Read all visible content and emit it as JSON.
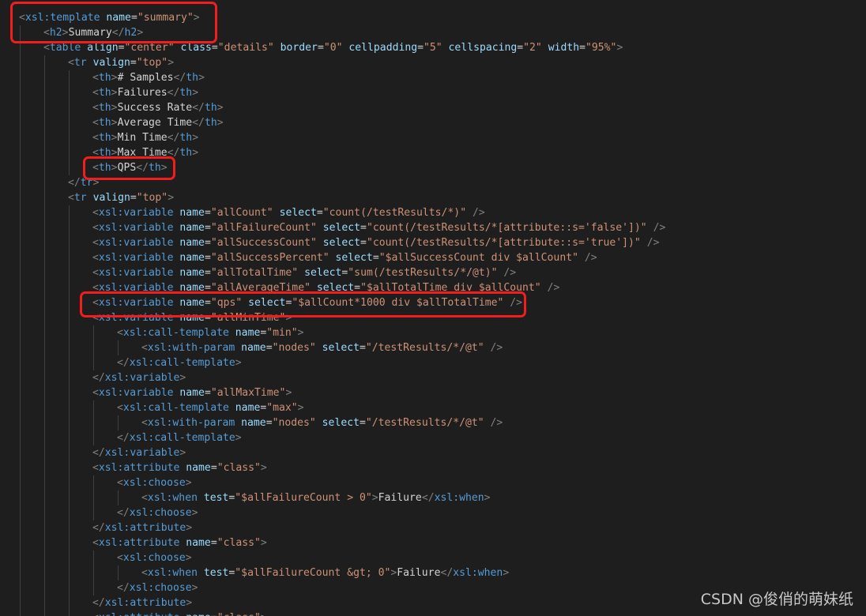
{
  "editor": {
    "lines": [
      [
        [
          "<",
          "punc"
        ],
        [
          "xsl:template",
          "tag"
        ],
        [
          " ",
          "text"
        ],
        [
          "name",
          "attr"
        ],
        [
          "=",
          "text"
        ],
        [
          "\"summary\"",
          "str"
        ],
        [
          ">",
          "punc"
        ]
      ],
      [
        [
          "<",
          "punc"
        ],
        [
          "h2",
          "tag"
        ],
        [
          ">",
          "punc"
        ],
        [
          "Summary",
          "text"
        ],
        [
          "</",
          "punc"
        ],
        [
          "h2",
          "tag"
        ],
        [
          ">",
          "punc"
        ]
      ],
      [
        [
          "<",
          "punc"
        ],
        [
          "table",
          "tag"
        ],
        [
          " ",
          "text"
        ],
        [
          "align",
          "attr"
        ],
        [
          "=",
          "text"
        ],
        [
          "\"center\"",
          "str"
        ],
        [
          " ",
          "text"
        ],
        [
          "class",
          "attr"
        ],
        [
          "=",
          "text"
        ],
        [
          "\"details\"",
          "str"
        ],
        [
          " ",
          "text"
        ],
        [
          "border",
          "attr"
        ],
        [
          "=",
          "text"
        ],
        [
          "\"0\"",
          "str"
        ],
        [
          " ",
          "text"
        ],
        [
          "cellpadding",
          "attr"
        ],
        [
          "=",
          "text"
        ],
        [
          "\"5\"",
          "str"
        ],
        [
          " ",
          "text"
        ],
        [
          "cellspacing",
          "attr"
        ],
        [
          "=",
          "text"
        ],
        [
          "\"2\"",
          "str"
        ],
        [
          " ",
          "text"
        ],
        [
          "width",
          "attr"
        ],
        [
          "=",
          "text"
        ],
        [
          "\"95%\"",
          "str"
        ],
        [
          ">",
          "punc"
        ]
      ],
      [
        [
          "<",
          "punc"
        ],
        [
          "tr",
          "tag"
        ],
        [
          " ",
          "text"
        ],
        [
          "valign",
          "attr"
        ],
        [
          "=",
          "text"
        ],
        [
          "\"top\"",
          "str"
        ],
        [
          ">",
          "punc"
        ]
      ],
      [
        [
          "<",
          "punc"
        ],
        [
          "th",
          "tag"
        ],
        [
          ">",
          "punc"
        ],
        [
          "# Samples",
          "text"
        ],
        [
          "</",
          "punc"
        ],
        [
          "th",
          "tag"
        ],
        [
          ">",
          "punc"
        ]
      ],
      [
        [
          "<",
          "punc"
        ],
        [
          "th",
          "tag"
        ],
        [
          ">",
          "punc"
        ],
        [
          "Failures",
          "text"
        ],
        [
          "</",
          "punc"
        ],
        [
          "th",
          "tag"
        ],
        [
          ">",
          "punc"
        ]
      ],
      [
        [
          "<",
          "punc"
        ],
        [
          "th",
          "tag"
        ],
        [
          ">",
          "punc"
        ],
        [
          "Success Rate",
          "text"
        ],
        [
          "</",
          "punc"
        ],
        [
          "th",
          "tag"
        ],
        [
          ">",
          "punc"
        ]
      ],
      [
        [
          "<",
          "punc"
        ],
        [
          "th",
          "tag"
        ],
        [
          ">",
          "punc"
        ],
        [
          "Average Time",
          "text"
        ],
        [
          "</",
          "punc"
        ],
        [
          "th",
          "tag"
        ],
        [
          ">",
          "punc"
        ]
      ],
      [
        [
          "<",
          "punc"
        ],
        [
          "th",
          "tag"
        ],
        [
          ">",
          "punc"
        ],
        [
          "Min Time",
          "text"
        ],
        [
          "</",
          "punc"
        ],
        [
          "th",
          "tag"
        ],
        [
          ">",
          "punc"
        ]
      ],
      [
        [
          "<",
          "punc"
        ],
        [
          "th",
          "tag"
        ],
        [
          ">",
          "punc"
        ],
        [
          "Max Time",
          "text"
        ],
        [
          "</",
          "punc"
        ],
        [
          "th",
          "tag"
        ],
        [
          ">",
          "punc"
        ]
      ],
      [
        [
          "<",
          "punc"
        ],
        [
          "th",
          "tag"
        ],
        [
          ">",
          "punc"
        ],
        [
          "QPS",
          "text"
        ],
        [
          "</",
          "punc"
        ],
        [
          "th",
          "tag"
        ],
        [
          ">",
          "punc"
        ]
      ],
      [
        [
          "</",
          "punc"
        ],
        [
          "tr",
          "tag"
        ],
        [
          ">",
          "punc"
        ]
      ],
      [
        [
          "<",
          "punc"
        ],
        [
          "tr",
          "tag"
        ],
        [
          " ",
          "text"
        ],
        [
          "valign",
          "attr"
        ],
        [
          "=",
          "text"
        ],
        [
          "\"top\"",
          "str"
        ],
        [
          ">",
          "punc"
        ]
      ],
      [
        [
          "<",
          "punc"
        ],
        [
          "xsl:variable",
          "tag"
        ],
        [
          " ",
          "text"
        ],
        [
          "name",
          "attr"
        ],
        [
          "=",
          "text"
        ],
        [
          "\"allCount\"",
          "str"
        ],
        [
          " ",
          "text"
        ],
        [
          "select",
          "attr"
        ],
        [
          "=",
          "text"
        ],
        [
          "\"count(/testResults/*)\"",
          "str"
        ],
        [
          " ",
          "text"
        ],
        [
          "/>",
          "punc"
        ]
      ],
      [
        [
          "<",
          "punc"
        ],
        [
          "xsl:variable",
          "tag"
        ],
        [
          " ",
          "text"
        ],
        [
          "name",
          "attr"
        ],
        [
          "=",
          "text"
        ],
        [
          "\"allFailureCount\"",
          "str"
        ],
        [
          " ",
          "text"
        ],
        [
          "select",
          "attr"
        ],
        [
          "=",
          "text"
        ],
        [
          "\"count(/testResults/*[attribute::s='false'])\"",
          "str"
        ],
        [
          " ",
          "text"
        ],
        [
          "/>",
          "punc"
        ]
      ],
      [
        [
          "<",
          "punc"
        ],
        [
          "xsl:variable",
          "tag"
        ],
        [
          " ",
          "text"
        ],
        [
          "name",
          "attr"
        ],
        [
          "=",
          "text"
        ],
        [
          "\"allSuccessCount\"",
          "str"
        ],
        [
          " ",
          "text"
        ],
        [
          "select",
          "attr"
        ],
        [
          "=",
          "text"
        ],
        [
          "\"count(/testResults/*[attribute::s='true'])\"",
          "str"
        ],
        [
          " ",
          "text"
        ],
        [
          "/>",
          "punc"
        ]
      ],
      [
        [
          "<",
          "punc"
        ],
        [
          "xsl:variable",
          "tag"
        ],
        [
          " ",
          "text"
        ],
        [
          "name",
          "attr"
        ],
        [
          "=",
          "text"
        ],
        [
          "\"allSuccessPercent\"",
          "str"
        ],
        [
          " ",
          "text"
        ],
        [
          "select",
          "attr"
        ],
        [
          "=",
          "text"
        ],
        [
          "\"$allSuccessCount div $allCount\"",
          "str"
        ],
        [
          " ",
          "text"
        ],
        [
          "/>",
          "punc"
        ]
      ],
      [
        [
          "<",
          "punc"
        ],
        [
          "xsl:variable",
          "tag"
        ],
        [
          " ",
          "text"
        ],
        [
          "name",
          "attr"
        ],
        [
          "=",
          "text"
        ],
        [
          "\"allTotalTime\"",
          "str"
        ],
        [
          " ",
          "text"
        ],
        [
          "select",
          "attr"
        ],
        [
          "=",
          "text"
        ],
        [
          "\"sum(/testResults/*/@t)\"",
          "str"
        ],
        [
          " ",
          "text"
        ],
        [
          "/>",
          "punc"
        ]
      ],
      [
        [
          "<",
          "punc"
        ],
        [
          "xsl:variable",
          "tag"
        ],
        [
          " ",
          "text"
        ],
        [
          "name",
          "attr"
        ],
        [
          "=",
          "text"
        ],
        [
          "\"allAverageTime\"",
          "str"
        ],
        [
          " ",
          "text"
        ],
        [
          "select",
          "attr"
        ],
        [
          "=",
          "text"
        ],
        [
          "\"$allTotalTime div $allCount\"",
          "str"
        ],
        [
          " ",
          "text"
        ],
        [
          "/>",
          "punc"
        ]
      ],
      [
        [
          "<",
          "punc"
        ],
        [
          "xsl:variable",
          "tag"
        ],
        [
          " ",
          "text"
        ],
        [
          "name",
          "attr"
        ],
        [
          "=",
          "text"
        ],
        [
          "\"qps\"",
          "str"
        ],
        [
          " ",
          "text"
        ],
        [
          "select",
          "attr"
        ],
        [
          "=",
          "text"
        ],
        [
          "\"$allCount*1000 div $allTotalTime\"",
          "str"
        ],
        [
          " ",
          "text"
        ],
        [
          "/>",
          "punc"
        ]
      ],
      [
        [
          "<",
          "punc"
        ],
        [
          "xsl:variable",
          "tag"
        ],
        [
          " ",
          "text"
        ],
        [
          "name",
          "attr"
        ],
        [
          "=",
          "text"
        ],
        [
          "\"allMinTime\"",
          "str"
        ],
        [
          ">",
          "punc"
        ]
      ],
      [
        [
          "<",
          "punc"
        ],
        [
          "xsl:call-template",
          "tag"
        ],
        [
          " ",
          "text"
        ],
        [
          "name",
          "attr"
        ],
        [
          "=",
          "text"
        ],
        [
          "\"min\"",
          "str"
        ],
        [
          ">",
          "punc"
        ]
      ],
      [
        [
          "<",
          "punc"
        ],
        [
          "xsl:with-param",
          "tag"
        ],
        [
          " ",
          "text"
        ],
        [
          "name",
          "attr"
        ],
        [
          "=",
          "text"
        ],
        [
          "\"nodes\"",
          "str"
        ],
        [
          " ",
          "text"
        ],
        [
          "select",
          "attr"
        ],
        [
          "=",
          "text"
        ],
        [
          "\"/testResults/*/@t\"",
          "str"
        ],
        [
          " ",
          "text"
        ],
        [
          "/>",
          "punc"
        ]
      ],
      [
        [
          "</",
          "punc"
        ],
        [
          "xsl:call-template",
          "tag"
        ],
        [
          ">",
          "punc"
        ]
      ],
      [
        [
          "</",
          "punc"
        ],
        [
          "xsl:variable",
          "tag"
        ],
        [
          ">",
          "punc"
        ]
      ],
      [
        [
          "<",
          "punc"
        ],
        [
          "xsl:variable",
          "tag"
        ],
        [
          " ",
          "text"
        ],
        [
          "name",
          "attr"
        ],
        [
          "=",
          "text"
        ],
        [
          "\"allMaxTime\"",
          "str"
        ],
        [
          ">",
          "punc"
        ]
      ],
      [
        [
          "<",
          "punc"
        ],
        [
          "xsl:call-template",
          "tag"
        ],
        [
          " ",
          "text"
        ],
        [
          "name",
          "attr"
        ],
        [
          "=",
          "text"
        ],
        [
          "\"max\"",
          "str"
        ],
        [
          ">",
          "punc"
        ]
      ],
      [
        [
          "<",
          "punc"
        ],
        [
          "xsl:with-param",
          "tag"
        ],
        [
          " ",
          "text"
        ],
        [
          "name",
          "attr"
        ],
        [
          "=",
          "text"
        ],
        [
          "\"nodes\"",
          "str"
        ],
        [
          " ",
          "text"
        ],
        [
          "select",
          "attr"
        ],
        [
          "=",
          "text"
        ],
        [
          "\"/testResults/*/@t\"",
          "str"
        ],
        [
          " ",
          "text"
        ],
        [
          "/>",
          "punc"
        ]
      ],
      [
        [
          "</",
          "punc"
        ],
        [
          "xsl:call-template",
          "tag"
        ],
        [
          ">",
          "punc"
        ]
      ],
      [
        [
          "</",
          "punc"
        ],
        [
          "xsl:variable",
          "tag"
        ],
        [
          ">",
          "punc"
        ]
      ],
      [
        [
          "<",
          "punc"
        ],
        [
          "xsl:attribute",
          "tag"
        ],
        [
          " ",
          "text"
        ],
        [
          "name",
          "attr"
        ],
        [
          "=",
          "text"
        ],
        [
          "\"class\"",
          "str"
        ],
        [
          ">",
          "punc"
        ]
      ],
      [
        [
          "<",
          "punc"
        ],
        [
          "xsl:choose",
          "tag"
        ],
        [
          ">",
          "punc"
        ]
      ],
      [
        [
          "<",
          "punc"
        ],
        [
          "xsl:when",
          "tag"
        ],
        [
          " ",
          "text"
        ],
        [
          "test",
          "attr"
        ],
        [
          "=",
          "text"
        ],
        [
          "\"$allFailureCount > 0\"",
          "str"
        ],
        [
          ">",
          "punc"
        ],
        [
          "Failure",
          "text"
        ],
        [
          "</",
          "punc"
        ],
        [
          "xsl:when",
          "tag"
        ],
        [
          ">",
          "punc"
        ]
      ],
      [
        [
          "</",
          "punc"
        ],
        [
          "xsl:choose",
          "tag"
        ],
        [
          ">",
          "punc"
        ]
      ],
      [
        [
          "</",
          "punc"
        ],
        [
          "xsl:attribute",
          "tag"
        ],
        [
          ">",
          "punc"
        ]
      ],
      [
        [
          "<",
          "punc"
        ],
        [
          "xsl:attribute",
          "tag"
        ],
        [
          " ",
          "text"
        ],
        [
          "name",
          "attr"
        ],
        [
          "=",
          "text"
        ],
        [
          "\"class\"",
          "str"
        ],
        [
          ">",
          "punc"
        ]
      ],
      [
        [
          "<",
          "punc"
        ],
        [
          "xsl:choose",
          "tag"
        ],
        [
          ">",
          "punc"
        ]
      ],
      [
        [
          "<",
          "punc"
        ],
        [
          "xsl:when",
          "tag"
        ],
        [
          " ",
          "text"
        ],
        [
          "test",
          "attr"
        ],
        [
          "=",
          "text"
        ],
        [
          "\"$allFailureCount &gt; 0\"",
          "str"
        ],
        [
          ">",
          "punc"
        ],
        [
          "Failure",
          "text"
        ],
        [
          "</",
          "punc"
        ],
        [
          "xsl:when",
          "tag"
        ],
        [
          ">",
          "punc"
        ]
      ],
      [
        [
          "</",
          "punc"
        ],
        [
          "xsl:choose",
          "tag"
        ],
        [
          ">",
          "punc"
        ]
      ],
      [
        [
          "</",
          "punc"
        ],
        [
          "xsl:attribute",
          "tag"
        ],
        [
          ">",
          "punc"
        ]
      ],
      [
        [
          "<",
          "punc"
        ],
        [
          "xsl:attribute",
          "tag"
        ],
        [
          " ",
          "text"
        ],
        [
          "name",
          "attr"
        ],
        [
          "=",
          "text"
        ],
        [
          "\"class\"",
          "str"
        ],
        [
          ">",
          "punc"
        ]
      ]
    ],
    "colors": {
      "tag": "#569cd6",
      "attr": "#9cdcfe",
      "string": "#ce9178",
      "punctuation": "#808080",
      "text": "#d4d4d4",
      "background": "#1e1e1e",
      "highlight": "#f21d1d"
    }
  },
  "watermark": "CSDN @俊俏的萌妹纸"
}
